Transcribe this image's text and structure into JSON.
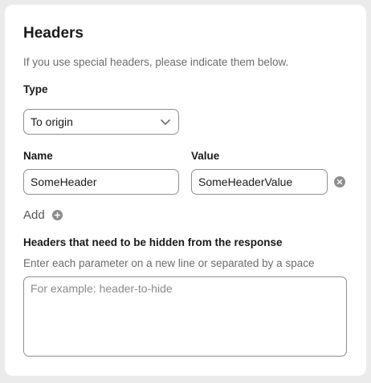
{
  "card": {
    "title": "Headers",
    "subtitle": "If you use special headers, please indicate them below."
  },
  "type": {
    "label": "Type",
    "selected": "To origin",
    "icon": "chevron-down-icon"
  },
  "header_row": {
    "name_label": "Name",
    "value_label": "Value",
    "name_value": "SomeHeader",
    "value_value": "SomeHeaderValue",
    "clear_icon": "clear-circle-icon"
  },
  "add": {
    "label": "Add",
    "icon": "plus-circle-icon"
  },
  "hidden_headers": {
    "label": "Headers that need to be hidden from the response",
    "help": "Enter each parameter on a new line or separated by a space",
    "placeholder": "For example: header-to-hide",
    "value": ""
  }
}
